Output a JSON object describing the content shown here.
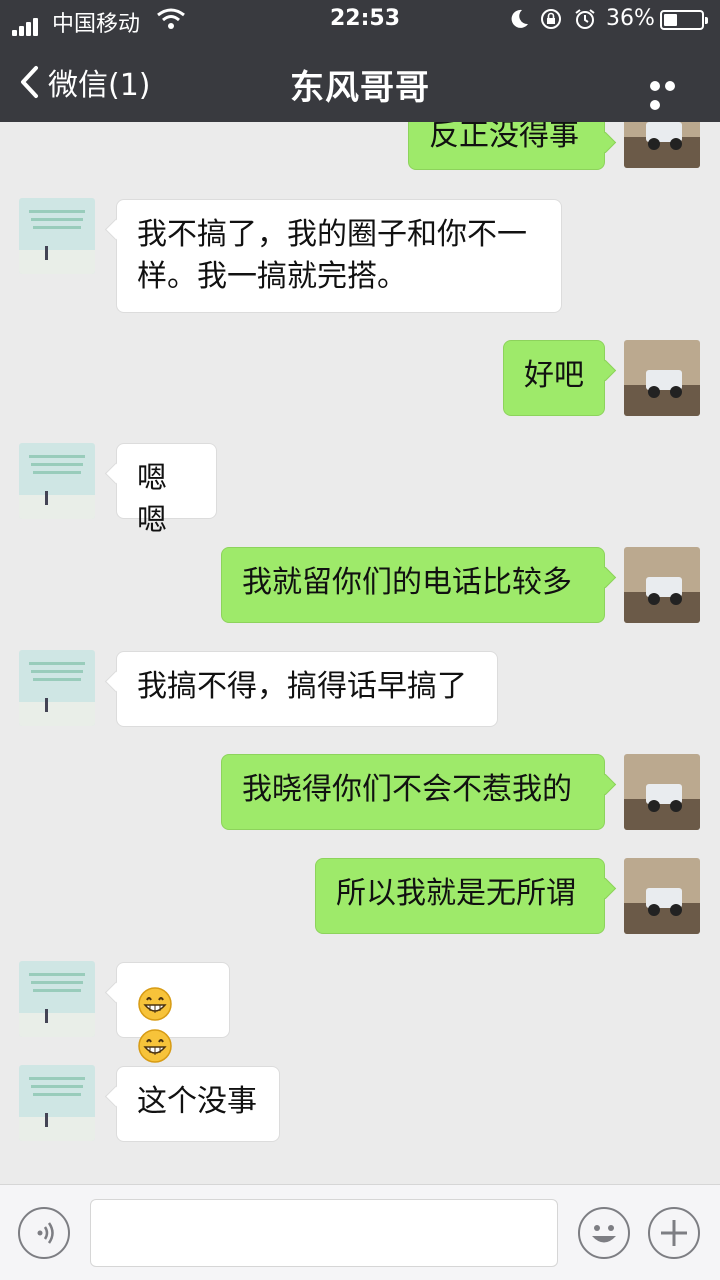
{
  "status_bar": {
    "carrier": "中国移动",
    "time": "22:53",
    "battery": "36%",
    "battery_level": 0.36
  },
  "header": {
    "back_label": "微信(1)",
    "title": "东风哥哥"
  },
  "messages": [
    {
      "side": "out",
      "text": "反正没得事"
    },
    {
      "side": "in",
      "text": "我不搞了，我的圈子和你不一样。我一搞就完搭。"
    },
    {
      "side": "out",
      "text": "好吧"
    },
    {
      "side": "in",
      "text": "嗯嗯"
    },
    {
      "side": "out",
      "text": "我就留你们的电话比较多"
    },
    {
      "side": "in",
      "text": "我搞不得，搞得话早搞了"
    },
    {
      "side": "out",
      "text": "我晓得你们不会不惹我的"
    },
    {
      "side": "out",
      "text": "所以我就是无所谓"
    },
    {
      "side": "in",
      "text": "",
      "emoji": [
        "grin-emoji",
        "grin-emoji"
      ]
    },
    {
      "side": "in",
      "text": "这个没事"
    }
  ],
  "icons": {
    "back": "chevron-left-icon",
    "more": "more-dots-icon",
    "voice": "voice-icon",
    "emoji": "emoji-icon",
    "plus": "plus-icon"
  },
  "colors": {
    "header_bg": "#393a3f",
    "chat_bg": "#ebebeb",
    "outgoing_bubble": "#9eea6a",
    "incoming_bubble": "#ffffff"
  }
}
